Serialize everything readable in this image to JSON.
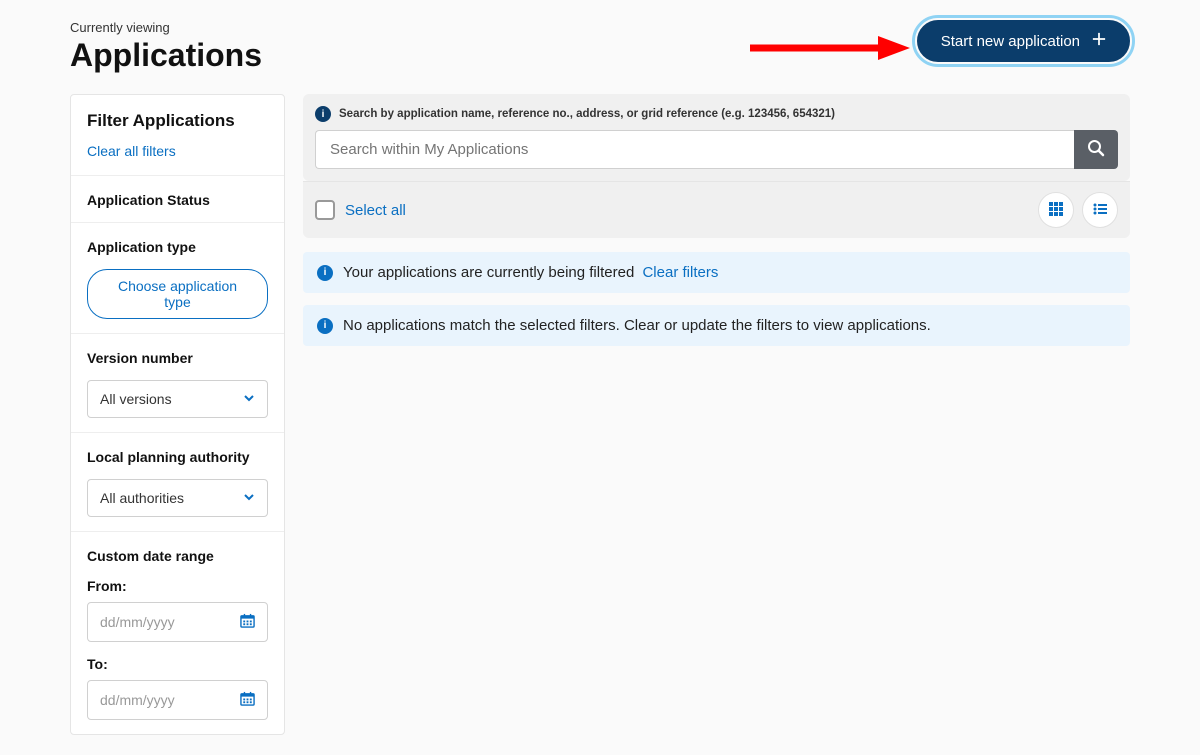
{
  "header": {
    "eyebrow": "Currently viewing",
    "title": "Applications",
    "start_button": "Start new application"
  },
  "sidebar": {
    "title": "Filter Applications",
    "clear_all": "Clear all filters",
    "status_label": "Application Status",
    "type_label": "Application type",
    "choose_type_btn": "Choose application type",
    "version_label": "Version number",
    "version_value": "All versions",
    "lpa_label": "Local planning authority",
    "lpa_value": "All authorities",
    "date_range_label": "Custom date range",
    "from_label": "From:",
    "to_label": "To:",
    "date_placeholder": "dd/mm/yyyy"
  },
  "main": {
    "search_hint": "Search by application name, reference no., address, or grid reference (e.g. 123456, 654321)",
    "search_placeholder": "Search within My Applications",
    "select_all": "Select all",
    "filtered_msg": "Your applications are currently being filtered",
    "clear_filters_link": "Clear filters",
    "empty_msg": "No applications match the selected filters. Clear or update the filters to view applications."
  }
}
